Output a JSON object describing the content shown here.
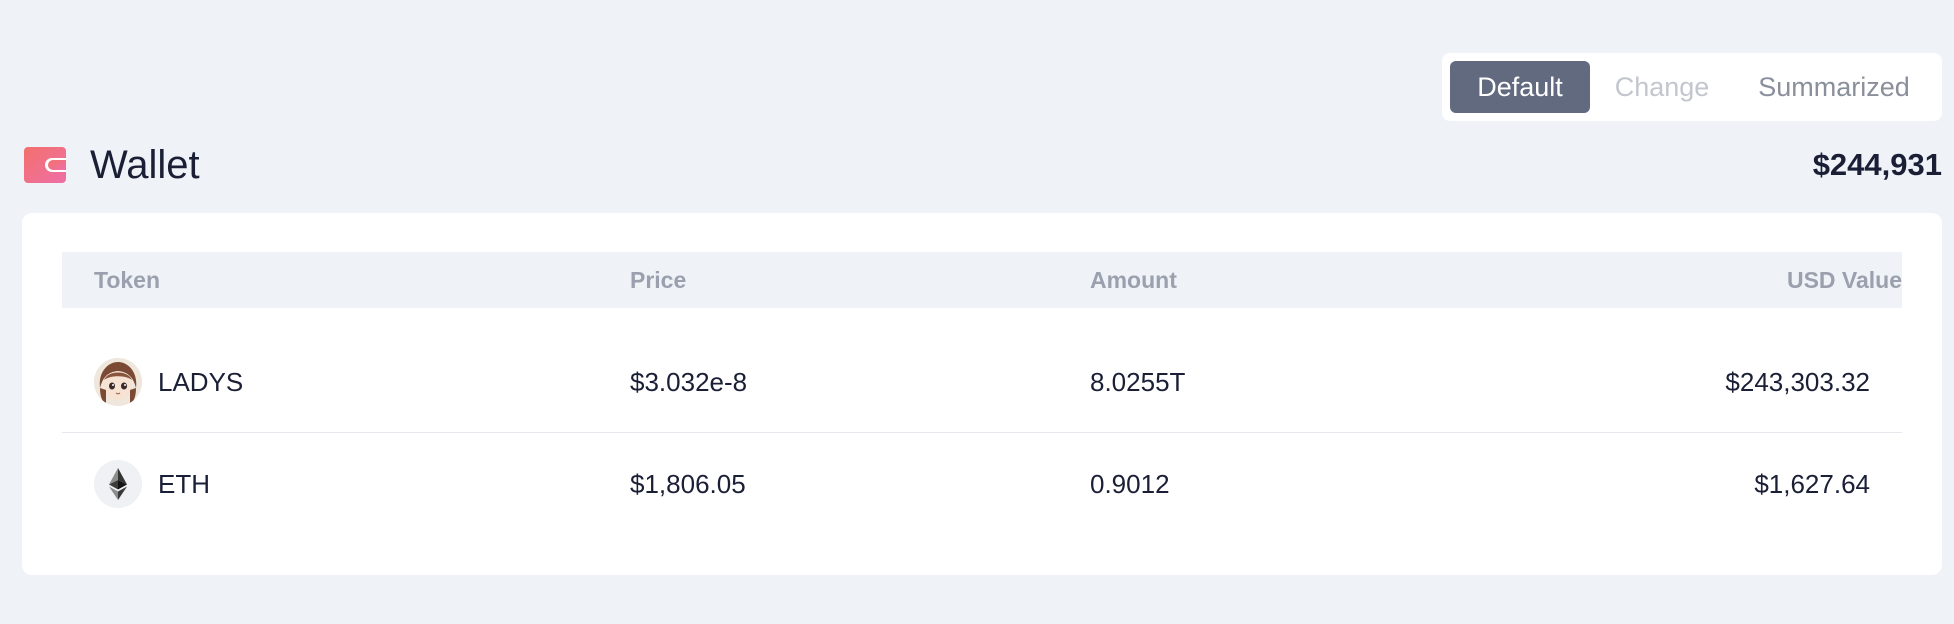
{
  "view_toggle": {
    "options": [
      {
        "label": "Default",
        "state": "active"
      },
      {
        "label": "Change",
        "state": "disabled"
      },
      {
        "label": "Summarized",
        "state": "normal"
      }
    ]
  },
  "wallet": {
    "icon": "wallet-icon",
    "title": "Wallet",
    "total": "$244,931"
  },
  "table": {
    "headers": {
      "token": "Token",
      "price": "Price",
      "amount": "Amount",
      "usd_value": "USD Value"
    },
    "rows": [
      {
        "token": "LADYS",
        "icon": "ladys-token-icon",
        "price": "$3.032e-8",
        "amount": "8.0255T",
        "usd_value": "$243,303.32"
      },
      {
        "token": "ETH",
        "icon": "eth-token-icon",
        "price": "$1,806.05",
        "amount": "0.9012",
        "usd_value": "$1,627.64"
      }
    ]
  },
  "colors": {
    "background": "#eff2f7",
    "active_toggle": "#626a80",
    "wallet_icon_start": "#f3706a",
    "wallet_icon_end": "#ee6fa8",
    "text_primary": "#1a1f36",
    "text_muted": "#9aa0ad"
  }
}
